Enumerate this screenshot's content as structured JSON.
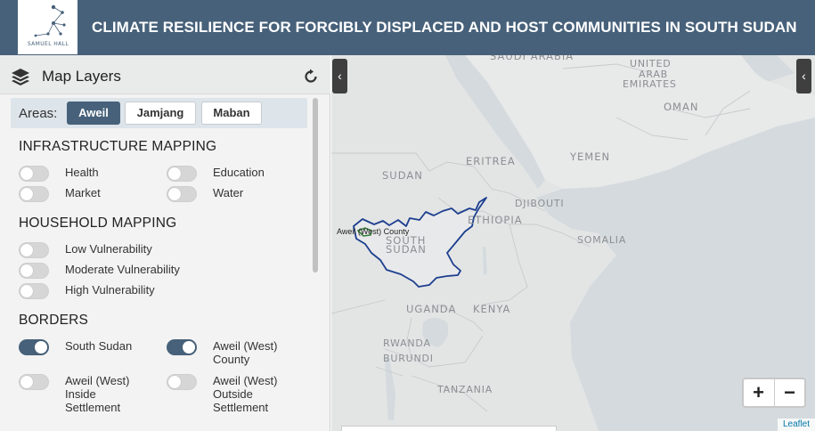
{
  "header": {
    "title": "CLIMATE RESILIENCE FOR FORCIBLY DISPLACED AND HOST COMMUNITIES IN SOUTH SUDAN",
    "logo_text": "SAMUEL HALL",
    "background_color": "#47617a"
  },
  "sidebar": {
    "panel_title": "Map Layers",
    "layers_icon": "layers-icon",
    "reset_icon": "reset-icon",
    "areas": {
      "label": "Areas:",
      "options": [
        "Aweil",
        "Jamjang",
        "Maban"
      ],
      "selected": "Aweil"
    },
    "sections": [
      {
        "title": "INFRASTRUCTURE MAPPING",
        "items": [
          {
            "label": "Health",
            "on": false
          },
          {
            "label": "Education",
            "on": false
          },
          {
            "label": "Market",
            "on": false
          },
          {
            "label": "Water",
            "on": false
          }
        ]
      },
      {
        "title": "HOUSEHOLD MAPPING",
        "items": [
          {
            "label": "Low Vulnerability",
            "on": false
          },
          {
            "label": "Moderate Vulnerability",
            "on": false
          },
          {
            "label": "High Vulnerability",
            "on": false
          }
        ]
      },
      {
        "title": "BORDERS",
        "items": [
          {
            "label": "South Sudan",
            "on": true
          },
          {
            "label": "Aweil (West) County",
            "on": true
          },
          {
            "label": "Aweil (West) Inside Settlement",
            "on": false
          },
          {
            "label": "Aweil (West) Outside Settlement",
            "on": false
          }
        ]
      }
    ],
    "collapse_icon": "chevron-left-icon"
  },
  "map": {
    "labels": {
      "saudi_arabia": "SAUDI ARABIA",
      "uae_1": "UNITED",
      "uae_2": "ARAB",
      "uae_3": "EMIRATES",
      "oman": "OMAN",
      "eritrea": "ERITREA",
      "yemen": "YEMEN",
      "sudan": "SUDAN",
      "djibouti": "DJIBOUTI",
      "ethiopia": "ETHIOPIA",
      "south_sudan_1": "SOUTH",
      "south_sudan_2": "SUDAN",
      "somalia": "SOMALIA",
      "uganda": "UGANDA",
      "kenya": "KENYA",
      "rwanda": "RWANDA",
      "burundi": "BURUNDI",
      "tanzania": "TANZANIA"
    },
    "county_label": "Aweil (West) County",
    "zoom_in": "+",
    "zoom_out": "−",
    "attribution": "Leaflet",
    "border_color": "#1d3f8f",
    "county_color": "#2e7d32",
    "collapse_icon": "chevron-left-icon"
  }
}
